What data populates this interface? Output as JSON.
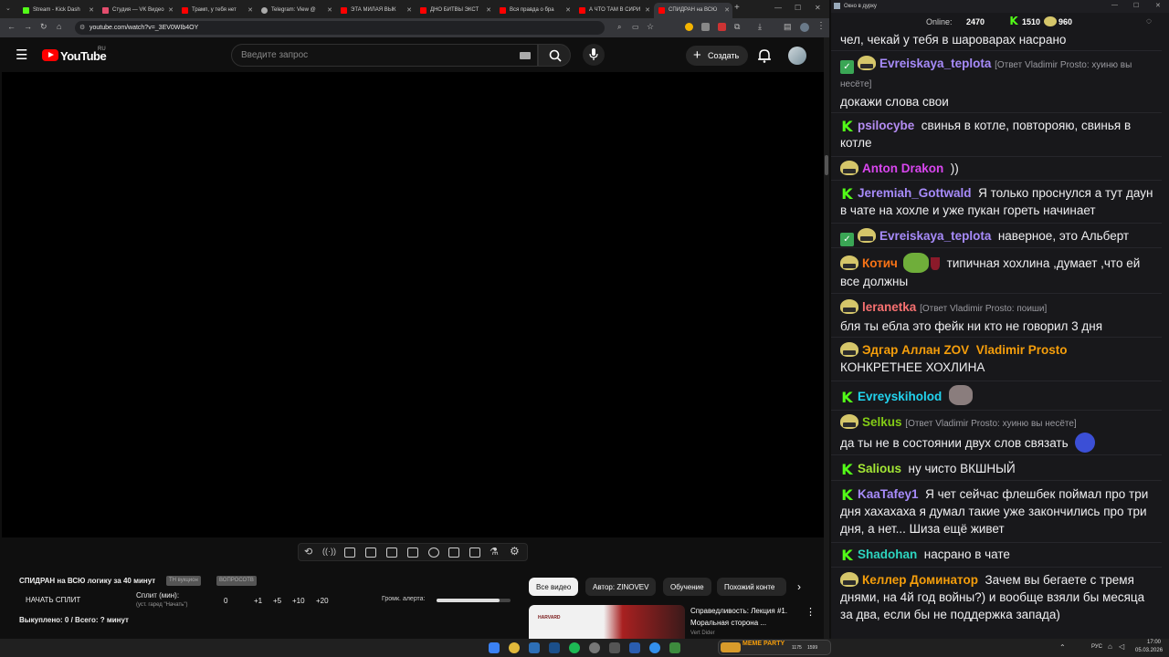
{
  "browser": {
    "tabs": [
      {
        "title": "Stream - Kick Dash",
        "color": "#53fc18"
      },
      {
        "title": "Студия — VK Видео",
        "color": "#e34d6d"
      },
      {
        "title": "Трамп, у тебя нет",
        "color": "#ff0000"
      },
      {
        "title": "Telegram: View @",
        "color": "#aaaaaa"
      },
      {
        "title": "ЭТА МИЛАЯ ВЫК",
        "color": "#ff0000"
      },
      {
        "title": "ДНО БИТВЫ ЭКСТ",
        "color": "#ff0000"
      },
      {
        "title": "Вся правда о бра",
        "color": "#ff0000"
      },
      {
        "title": "А ЧТО ТАМ В СИРИ",
        "color": "#ff0000"
      },
      {
        "title": "СПИДРАН на ВСЮ",
        "color": "#ff0000"
      }
    ],
    "url": "youtube.com/watch?v=_3EV0WIb4OY"
  },
  "youtube": {
    "logo": "YouTube",
    "region": "RU",
    "search_placeholder": "Введите запрос",
    "create_label": "Создать"
  },
  "speedrun": {
    "title": "СПИДРАН на ВСЮ логику за 40 минут",
    "pill1": "TH вукцион",
    "pill2": "ВОПРОСОТВ",
    "start_label": "НАЧАТЬ СПЛИТ",
    "split_label": "Сплит (мин):",
    "split_hint": "(уст. гаред \"Начать\")",
    "split_value": "0",
    "plus1": "+1",
    "plus5": "+5",
    "plus10": "+10",
    "plus20": "+20",
    "alert_label": "Громк. алерта:",
    "alert_volume": 0.85,
    "bought": "Выкуплено: 0 / Всего: ? минут"
  },
  "chips": [
    "Все видео",
    "Автор: ZINOVEV",
    "Обучение",
    "Похожий конте"
  ],
  "related": {
    "title": "Справедливость: Лекция #1.",
    "subtitle": "Моральная сторона ...",
    "thumb_label": "HARVARD",
    "channel": "Vert Dider"
  },
  "chat": {
    "window_title": "Окно в дурку",
    "online_label": "Online:",
    "online_count": "2470",
    "kick_count": "1510",
    "other_count": "960",
    "messages": [
      {
        "user": "",
        "text": "чел, чекай у тебя в шароварах насрано",
        "reply": "",
        "color": "#efeff1"
      },
      {
        "user": "Evreiskaya_teplota",
        "text": "докажи слова свои",
        "reply": "[Ответ Vladimir Prosto: хуиню вы несёте]",
        "color": "#a78bfa"
      },
      {
        "user": "psilocybe",
        "text": "свинья в котле, повторояю, свинья в котле",
        "reply": "",
        "color": "#b48cf2"
      },
      {
        "user": "Anton Drakon",
        "text": "))",
        "reply": "",
        "color": "#d946ef"
      },
      {
        "user": "Jeremiah_Gottwald",
        "text": "Я только проснулся а тут даун в чате на хохле и уже пукан гореть начинает",
        "reply": "",
        "color": "#a78bfa"
      },
      {
        "user": "Evreiskaya_teplota",
        "text": "наверное, это Альберт",
        "reply": "",
        "color": "#a78bfa"
      },
      {
        "user": "Котич",
        "text": "типичная хохлина ,думает ,что ей все должны",
        "reply": "",
        "color": "#f97316"
      },
      {
        "user": "leranetka",
        "text": "бля ты ебла это фейк ни кто не говорил 3 дня",
        "reply": "[Ответ Vladimir Prosto: поиши]",
        "color": "#f87171"
      },
      {
        "user": "Эдгар Аллан ZOV",
        "mention": "Vladimir Prosto",
        "text": "КОНКРЕТНЕЕ ХОХЛИНА",
        "reply": "",
        "color": "#f59e0b"
      },
      {
        "user": "Evreyskiholod",
        "text": "",
        "reply": "",
        "color": "#22d3ee"
      },
      {
        "user": "Selkus",
        "text": "да ты не в состоянии двух слов связать",
        "reply": "[Ответ Vladimir Prosto: хуиню вы несёте]",
        "color": "#84cc16"
      },
      {
        "user": "Salious",
        "text": "ну чисто ВКШНЫЙ",
        "reply": "",
        "color": "#a3e635"
      },
      {
        "user": "KaaTafey1",
        "text": "Я чет сейчас флешбек поймал про три дня хахахаха я думал такие уже закончились про три дня, а нет... Шиза ещё живет",
        "reply": "",
        "color": "#a78bfa"
      },
      {
        "user": "Shadohan",
        "text": "насрано в чате",
        "reply": "",
        "color": "#2dd4bf"
      },
      {
        "user": "Келлер Доминатор",
        "text": "Зачем вы бегаете с тремя днями, на 4й год войны?) и вообще взяли бы месяца за два, если бы не поддержка запада)",
        "reply": "",
        "color": "#f59e0b"
      }
    ]
  },
  "taskbar": {
    "widget": "MEME PARTY",
    "widget_count1": "1175",
    "widget_count2": "1599",
    "lang": "РУС",
    "time": "17:00",
    "date": "05.03.2026"
  }
}
